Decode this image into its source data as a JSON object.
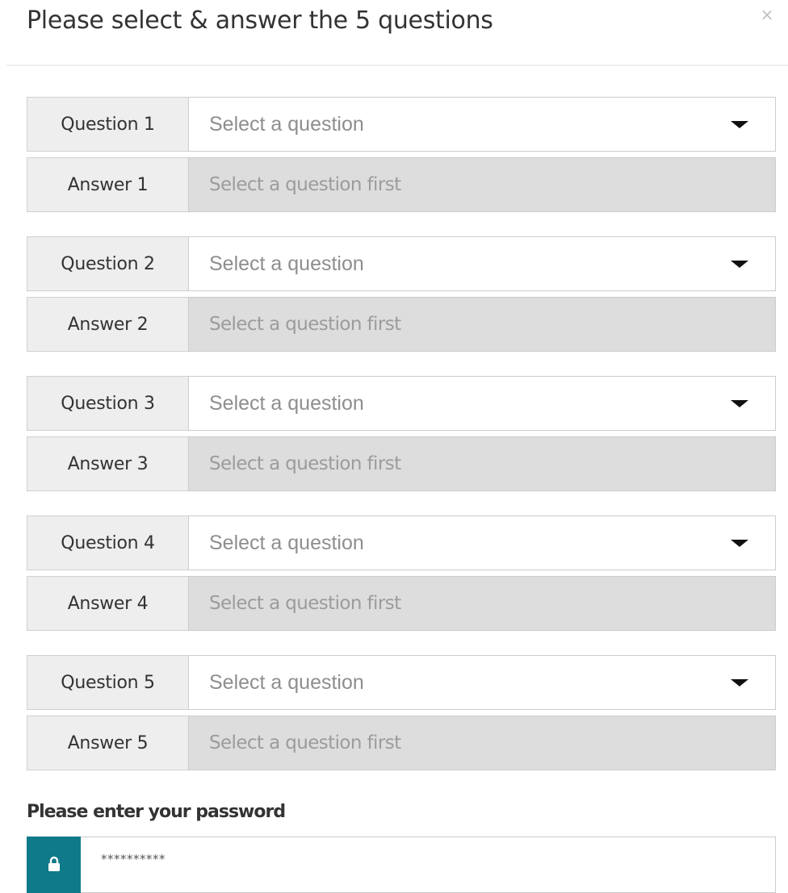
{
  "modal": {
    "title": "Please select & answer the 5 questions",
    "close_label": "×"
  },
  "questions": [
    {
      "question_label": "Question 1",
      "select_placeholder": "Select a question",
      "answer_label": "Answer 1",
      "answer_placeholder": "Select a question first"
    },
    {
      "question_label": "Question 2",
      "select_placeholder": "Select a question",
      "answer_label": "Answer 2",
      "answer_placeholder": "Select a question first"
    },
    {
      "question_label": "Question 3",
      "select_placeholder": "Select a question",
      "answer_label": "Answer 3",
      "answer_placeholder": "Select a question first"
    },
    {
      "question_label": "Question 4",
      "select_placeholder": "Select a question",
      "answer_label": "Answer 4",
      "answer_placeholder": "Select a question first"
    },
    {
      "question_label": "Question 5",
      "select_placeholder": "Select a question",
      "answer_label": "Answer 5",
      "answer_placeholder": "Select a question first"
    }
  ],
  "password": {
    "label": "Please enter your password",
    "value": "**********",
    "icon": "lock-icon"
  },
  "colors": {
    "accent": "#0e7a8a",
    "label_background": "#eeeeee",
    "disabled_background": "#dddddd"
  }
}
